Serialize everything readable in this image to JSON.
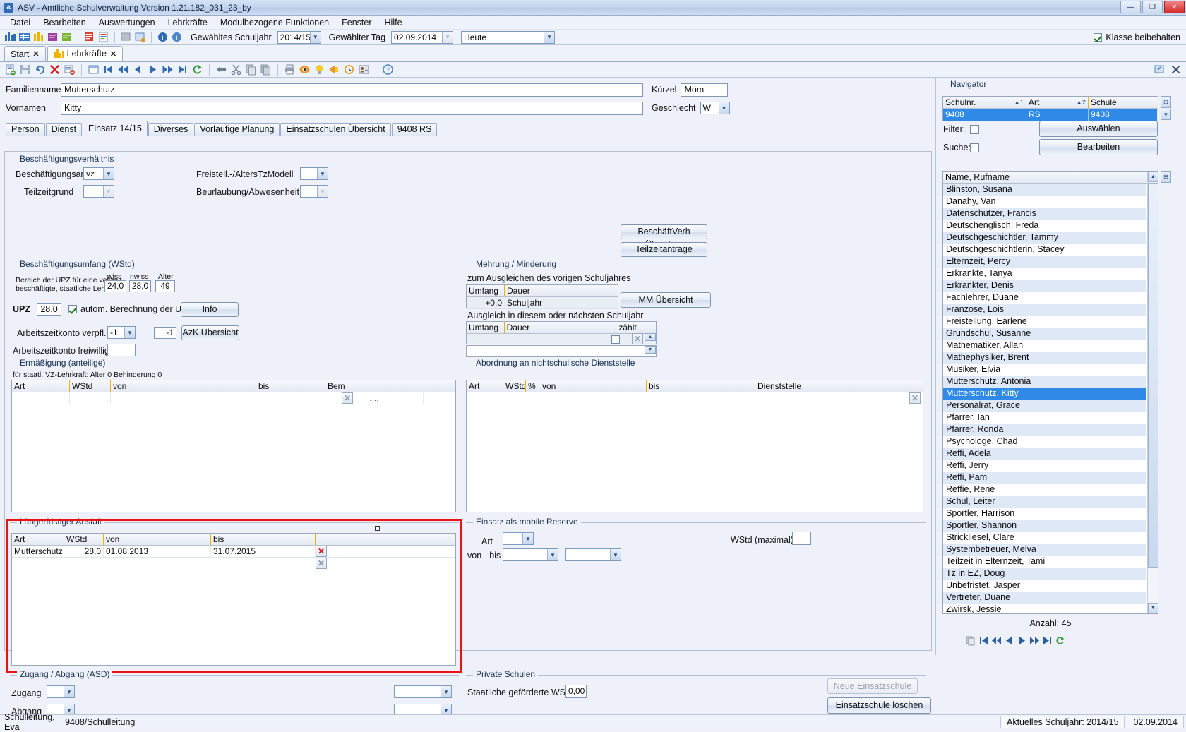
{
  "window": {
    "title": "ASV - Amtliche Schulverwaltung Version 1.21.182_031_23_by",
    "app_icon": "asv-app-icon",
    "minimize": "—",
    "maximize": "❐",
    "close": "✕"
  },
  "menu": [
    {
      "label": "Datei"
    },
    {
      "label": "Bearbeiten"
    },
    {
      "label": "Auswertungen"
    },
    {
      "label": "Lehrkräfte"
    },
    {
      "label": "Modulbezogene Funktionen"
    },
    {
      "label": "Fenster"
    },
    {
      "label": "Hilfe"
    }
  ],
  "toolbar": {
    "schuljahr_label": "Gewähltes Schuljahr",
    "schuljahr_value": "2014/15",
    "tag_label": "Gewählter Tag",
    "tag_value": "02.09.2014",
    "heute_value": "Heute",
    "klasse_beibehalten": "Klasse beibehalten"
  },
  "doc_tabs": [
    {
      "label": "Start",
      "close": "✕",
      "active": false
    },
    {
      "label": "Lehrkräfte",
      "close": "✕",
      "active": true
    }
  ],
  "person": {
    "familienname_label": "Familienname",
    "familienname_value": "Mutterschutz",
    "vornamen_label": "Vornamen",
    "vornamen_value": "Kitty",
    "kuerzel_label": "Kürzel",
    "kuerzel_value": "Mom",
    "geschlecht_label": "Geschlecht",
    "geschlecht_value": "W"
  },
  "inner_tabs": [
    {
      "label": "Person",
      "active": false
    },
    {
      "label": "Dienst",
      "active": false
    },
    {
      "label": "Einsatz 14/15",
      "active": true
    },
    {
      "label": "Diverses",
      "active": false
    },
    {
      "label": "Vorläufige Planung",
      "active": false
    },
    {
      "label": "Einsatzschulen Übersicht",
      "active": false
    },
    {
      "label": "9408 RS",
      "active": false
    }
  ],
  "beschaeftigungsverhaeltnis": {
    "title": "Beschäftigungsverhältnis",
    "beschaeftigungsart_label": "Beschäftigungsart",
    "beschaeftigungsart_value": "vz",
    "teilzeitgrund_label": "Teilzeitgrund",
    "teilzeitgrund_value": "",
    "freistell_label": "Freistell.-/AltersTzModell",
    "freistell_value": "",
    "beurlaubung_label": "Beurlaubung/Abwesenheit",
    "beurlaubung_value": "",
    "btn_beschaeftverh": "BeschäftVerh Übersic...",
    "btn_teilzeitantraege": "Teilzeitanträge"
  },
  "beschaeftigungsumfang": {
    "title": "Beschäftigungsumfang (WStd)",
    "hint_line1": "Bereich der UPZ für eine vollzeit-",
    "hint_line2": "beschäftigte, staatliche Lehrkraft",
    "wiss_label": "wiss",
    "wiss_value": "24,0",
    "nwiss_label": "nwiss",
    "nwiss_value": "28,0",
    "alter_label": "Alter",
    "alter_value": "49",
    "upz_label": "UPZ",
    "upz_value": "28,0",
    "autom_label": "autom. Berechnung der UPZ",
    "btn_info": "Info",
    "azk_verpfl_label": "Arbeitszeitkonto verpfl.",
    "azk_verpfl_value": "-1",
    "azk_verpfl_value2": "-1",
    "btn_azk": "AzK Übersicht",
    "azk_freiwillig_label": "Arbeitszeitkonto freiwillig",
    "azk_freiwillig_value": ""
  },
  "ermaessigung": {
    "title": "Ermäßigung (anteilige)",
    "hint": "für staatl. VZ-Lehrkraft: Alter 0 Behinderung 0",
    "columns": [
      "Art",
      "WStd",
      "von",
      "bis",
      "Bem",
      ""
    ],
    "rows": [
      {
        "art": "",
        "wstd": "",
        "von": "",
        "bis": "",
        "bem": "...."
      }
    ]
  },
  "mehrung": {
    "title": "Mehrung / Minderung",
    "sub1": "zum Ausgleichen des vorigen Schuljahres",
    "table1_columns": [
      "Umfang",
      "Dauer"
    ],
    "table1_rows": [
      {
        "umfang": "+0,0",
        "dauer": "Schuljahr"
      }
    ],
    "sub2": "Ausgleich in diesem oder nächsten Schuljahr",
    "table2_columns": [
      "Umfang",
      "Dauer",
      "zählt",
      "",
      ""
    ],
    "table2_rows": [
      {
        "umfang": "",
        "dauer": "",
        "zaehlt": ""
      }
    ],
    "btn_mm": "MM Übersicht"
  },
  "abordnung": {
    "title": "Abordnung an nichtschulische Dienststelle",
    "columns": [
      "Art",
      "WStd",
      "%",
      "von",
      "bis",
      "Dienststelle"
    ],
    "rows": []
  },
  "ausfall": {
    "title": "Längerfristiger Ausfall",
    "columns": [
      "Art",
      "WStd",
      "von",
      "bis",
      ""
    ],
    "rows": [
      {
        "art": "Mutterschutz",
        "wstd": "28,0",
        "von": "01.08.2013",
        "bis": "31.07.2015"
      }
    ],
    "highlight_color": "#ee1111"
  },
  "mobile_reserve": {
    "title": "Einsatz als mobile Reserve",
    "art_label": "Art",
    "art_value": "",
    "wstd_label": "WStd (maximal)",
    "wstd_value": "",
    "vonbis_label": "von - bis",
    "von_value": "",
    "bis_value": ""
  },
  "zugang_abgang": {
    "title": "Zugang / Abgang (ASD)",
    "zugang_label": "Zugang",
    "zugang_value": "",
    "zugang_value2": "",
    "abgang_label": "Abgang",
    "abgang_value": "",
    "abgang_value2": ""
  },
  "private_schulen": {
    "title": "Private Schulen",
    "wstd_label": "Staatliche geförderte WStd",
    "wstd_value": "0,00",
    "btn_neue": "Neue Einsatzschule",
    "btn_loeschen": "Einsatzschule löschen"
  },
  "navigator": {
    "title": "Navigator",
    "columns": [
      "Schulnr.",
      "Art",
      "Schule"
    ],
    "sort1": "1",
    "sort2": "2",
    "row": {
      "schulnr": "9408",
      "art": "RS",
      "schule": "9408"
    },
    "filter_label": "Filter:",
    "suche_label": "Suche:",
    "btn_auswaehlen": "Auswählen",
    "btn_bearbeiten": "Bearbeiten",
    "list_header": "Name, Rufname",
    "anzahl": "Anzahl: 45",
    "items": [
      "Blinston, Susana",
      "Danahy, Van",
      "Datenschützer, Francis",
      "Deutschenglisch, Freda",
      "Deutschgeschichtler, Tammy",
      "Deutschgeschichtlerin, Stacey",
      "Elternzeit, Percy",
      "Erkrankte, Tanya",
      "Erkrankter, Denis",
      "Fachlehrer, Duane",
      "Franzose, Lois",
      "Freistellung, Earlene",
      "Grundschul, Susanne",
      "Mathematiker, Allan",
      "Mathephysiker, Brent",
      "Musiker, Elvia",
      "Mutterschutz, Antonia",
      "Mutterschutz, Kitty",
      "Personalrat, Grace",
      "Pfarrer, Ian",
      "Pfarrer, Ronda",
      "Psychologe, Chad",
      "Reffi, Adela",
      "Reffi, Jerry",
      "Reffi, Pam",
      "Reffie, Rene",
      "Schul, Leiter",
      "Sportler, Harrison",
      "Sportler, Shannon",
      "Strickliesel, Clare",
      "Systembetreuer, Melva",
      "Teilzeit in Elternzeit, Tami",
      "Tz in EZ, Doug",
      "Unbefristet, Jasper",
      "Vertreter, Duane",
      "Zwirsk, Jessie"
    ],
    "selected_item": "Mutterschutz, Kitty"
  },
  "statusbar": {
    "user": "Schulleitung, Eva",
    "school": "9408/Schulleitung",
    "schuljahr": "Aktuelles Schuljahr: 2014/15",
    "datum": "02.09.2014"
  }
}
